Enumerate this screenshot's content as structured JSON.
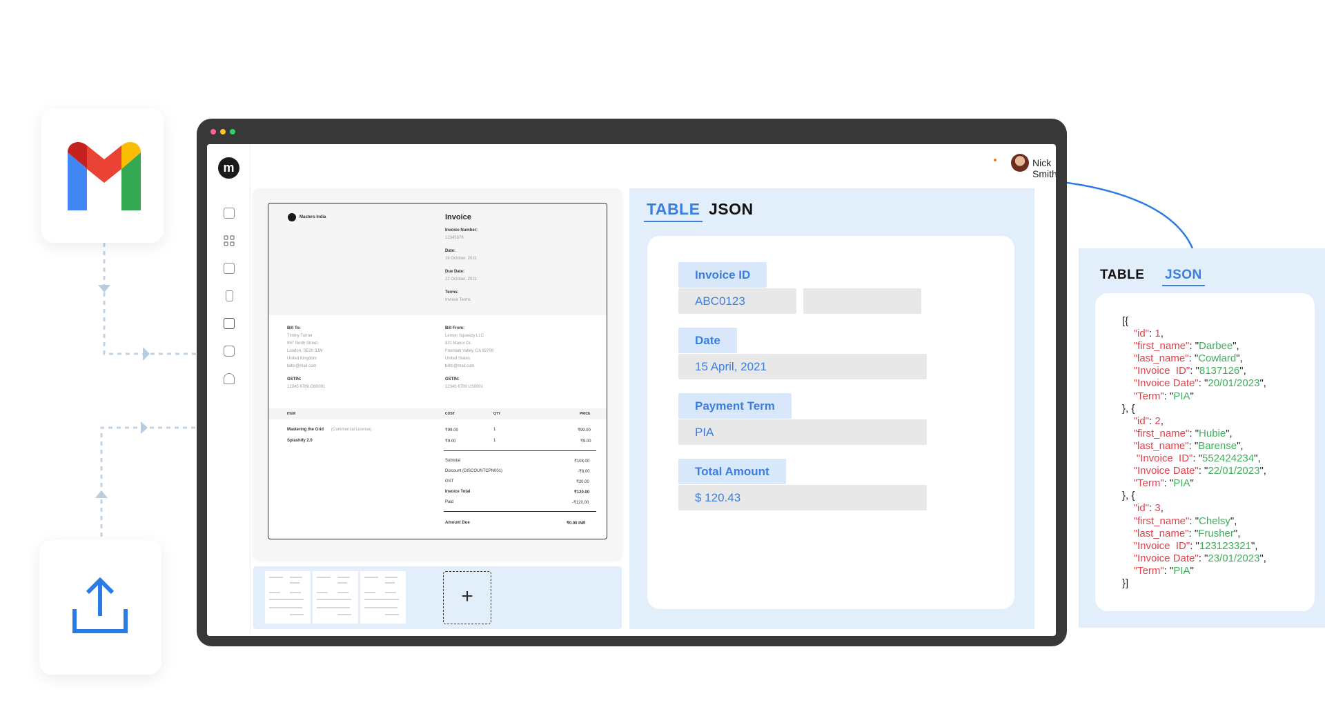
{
  "app": {
    "logo_text": "m",
    "user": {
      "name": "Nick Smith"
    }
  },
  "sources": {
    "gmail_icon": "gmail-logo",
    "upload_icon": "upload-icon"
  },
  "invoice": {
    "company": "Masters India",
    "title": "Invoice",
    "meta": [
      {
        "label": "Invoice Number:",
        "value": "12345678"
      },
      {
        "label": "Date:",
        "value": "18 October, 2021"
      },
      {
        "label": "Due Date:",
        "value": "22 October, 2021"
      },
      {
        "label": "Terms:",
        "value": "Invoice Terms"
      }
    ],
    "bill_to": {
      "heading": "Bill To:",
      "lines": [
        "Timmy Turner",
        "957 North Street",
        "London, SE20 3JW",
        "United Kingdom",
        "billto@mail.com"
      ],
      "gstin_label": "GSTIN:",
      "gstin": "12345 6789 OB0001"
    },
    "bill_from": {
      "heading": "Bill From:",
      "lines": [
        "Lemon Squeezy LLC",
        "831 Manor Dr.",
        "Fountain Valley, CA 92708",
        "United States",
        "billto@mail.com"
      ],
      "gstin_label": "GSTIN:",
      "gstin": "12345 6789 US0001"
    },
    "columns": [
      "ITEM",
      "COST",
      "QTY",
      "PRICE"
    ],
    "items": [
      {
        "name": "Mastering the Grid",
        "note": "(Commercial License)",
        "cost": "₹99.00",
        "qty": "1",
        "price": "₹99.00"
      },
      {
        "name": "Splashify 2.0",
        "note": "",
        "cost": "₹9.00",
        "qty": "1",
        "price": "₹9.00"
      }
    ],
    "totals": [
      {
        "label": "Subtotal",
        "value": "₹108.00",
        "bold": false
      },
      {
        "label": "Discount (DISCOUNTCPN001)",
        "value": "-₹8.00",
        "bold": false
      },
      {
        "label": "GST",
        "value": "₹20.00",
        "bold": false
      },
      {
        "label": "Invoice Total",
        "value": "₹120.00",
        "bold": true
      },
      {
        "label": "Paid",
        "value": "-₹120.00",
        "bold": false
      }
    ],
    "amount_due": {
      "label": "Amount Due",
      "value": "₹0.00 INR"
    }
  },
  "extraction": {
    "tabs": {
      "table": "TABLE",
      "json": "JSON"
    },
    "fields": [
      {
        "label": "Invoice ID",
        "value": "ABC0123",
        "value2": ""
      },
      {
        "label": "Date",
        "value": "15 April, 2021"
      },
      {
        "label": "Payment Term",
        "value": "PIA"
      },
      {
        "label": "Total Amount",
        "value": "$ 120.43"
      }
    ]
  },
  "json_view": {
    "tabs": {
      "table": "TABLE",
      "json": "JSON"
    },
    "records": [
      {
        "id": "1",
        "first_name": "Darbee",
        "last_name": "Cowlard",
        "invoice_id": "8137126",
        "invoice_date": "20/01/2023",
        "term": "PIA"
      },
      {
        "id": "2",
        "first_name": "Hubie",
        "last_name": "Barense",
        "invoice_id": "552424234",
        "invoice_date": "22/01/2023",
        "term": "PIA"
      },
      {
        "id": "3",
        "first_name": "Chelsy",
        "last_name": "Frusher",
        "invoice_id": "123123321",
        "invoice_date": "23/01/2023",
        "term": "PIA"
      }
    ]
  },
  "colors": {
    "accent": "#3a7ee0",
    "panel_bg": "#e3eefb",
    "json_key": "#e0424a",
    "json_value": "#3fae5a",
    "frame": "#383838"
  }
}
